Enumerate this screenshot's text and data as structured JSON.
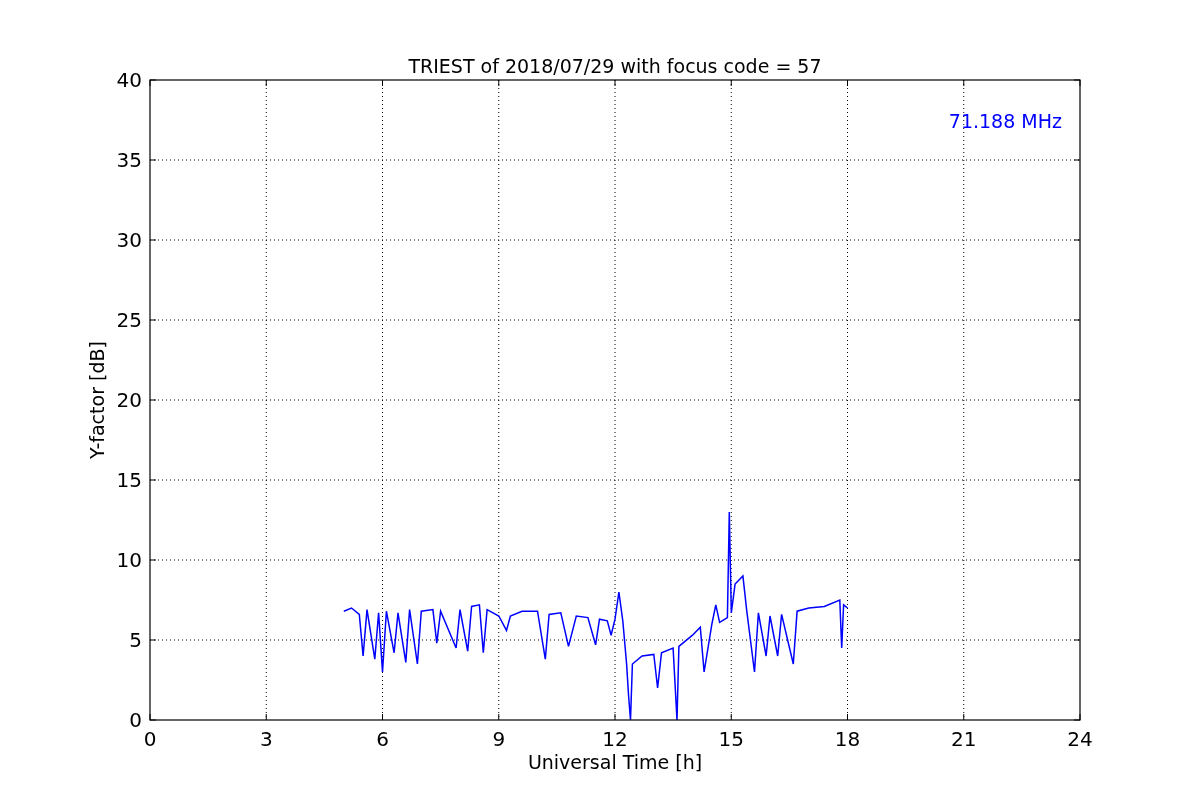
{
  "figure": {
    "chart_data": {
      "type": "line",
      "title": "TRIEST of 2018/07/29 with focus code = 57",
      "xlabel": "Universal Time [h]",
      "ylabel": "Y-factor [dB]",
      "x": [
        5.0,
        5.2,
        5.4,
        5.5,
        5.6,
        5.8,
        5.9,
        6.0,
        6.1,
        6.3,
        6.4,
        6.6,
        6.7,
        6.9,
        7.0,
        7.3,
        7.4,
        7.5,
        7.9,
        8.0,
        8.2,
        8.3,
        8.5,
        8.6,
        8.7,
        9.0,
        9.2,
        9.3,
        9.6,
        10.0,
        10.2,
        10.3,
        10.6,
        10.8,
        11.0,
        11.3,
        11.5,
        11.6,
        11.8,
        11.9,
        12.0,
        12.1,
        12.2,
        12.3,
        12.35,
        12.4,
        12.45,
        12.7,
        13.0,
        13.1,
        13.2,
        13.5,
        13.6,
        13.65,
        14.0,
        14.2,
        14.3,
        14.5,
        14.6,
        14.7,
        14.9,
        14.95,
        15.0,
        15.1,
        15.3,
        15.4,
        15.6,
        15.7,
        15.9,
        16.0,
        16.2,
        16.3,
        16.6,
        16.7,
        17.0,
        17.4,
        17.8,
        17.85,
        17.9,
        18.0
      ],
      "series": [
        {
          "name": "71.188 MHz",
          "color": "#0000ff",
          "values": [
            6.8,
            7.0,
            6.6,
            4.0,
            6.9,
            3.8,
            6.7,
            3.0,
            6.8,
            4.2,
            6.7,
            3.6,
            6.9,
            3.5,
            6.8,
            6.9,
            4.8,
            6.8,
            4.5,
            6.9,
            4.3,
            7.1,
            7.2,
            4.2,
            6.9,
            6.5,
            5.6,
            6.5,
            6.8,
            6.8,
            3.8,
            6.6,
            6.7,
            4.6,
            6.5,
            6.4,
            4.7,
            6.3,
            6.2,
            5.3,
            6.3,
            8.0,
            6.2,
            3.5,
            1.5,
            0,
            3.5,
            4.0,
            4.1,
            2.0,
            4.2,
            4.5,
            0,
            4.6,
            5.3,
            5.8,
            3.0,
            6.0,
            7.2,
            6.1,
            6.4,
            13.0,
            6.7,
            8.5,
            9.0,
            6.8,
            3.0,
            6.7,
            4.0,
            6.5,
            4.0,
            6.6,
            3.5,
            6.8,
            7.0,
            7.1,
            7.5,
            4.5,
            7.2,
            7.0
          ]
        }
      ],
      "xlim": [
        0,
        24
      ],
      "ylim": [
        0,
        40
      ],
      "xticks": [
        0,
        3,
        6,
        9,
        12,
        15,
        18,
        21,
        24
      ],
      "yticks": [
        0,
        5,
        10,
        15,
        20,
        25,
        30,
        35,
        40
      ],
      "grid": true
    }
  }
}
